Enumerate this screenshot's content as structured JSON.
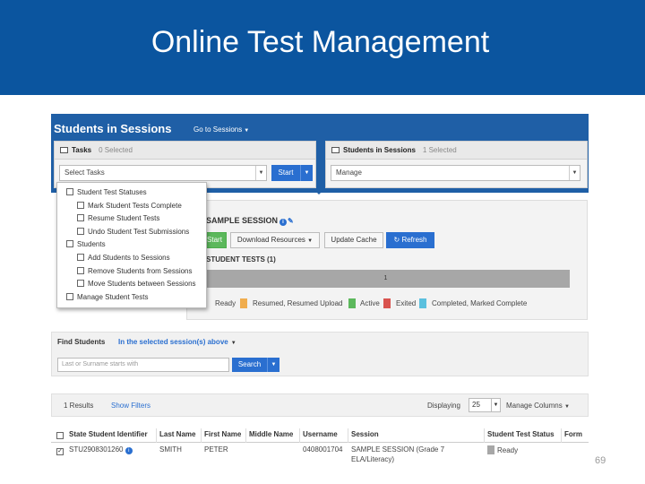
{
  "slide": {
    "title": "Online Test Management",
    "page_number": "69"
  },
  "header": {
    "title": "Students in Sessions",
    "goto_label": "Go to Sessions"
  },
  "tasks_panel": {
    "label": "Tasks",
    "count": "0 Selected",
    "select_value": "Select Tasks",
    "start_label": "Start"
  },
  "sis_panel": {
    "label": "Students in Sessions",
    "count": "1 Selected",
    "select_value": "Manage"
  },
  "dropdown": {
    "items": [
      {
        "label": "Student Test Statuses",
        "level": 0
      },
      {
        "label": "Mark Student Tests Complete",
        "level": 1
      },
      {
        "label": "Resume Student Tests",
        "level": 1
      },
      {
        "label": "Undo Student Test Submissions",
        "level": 1
      },
      {
        "label": "Students",
        "level": 0
      },
      {
        "label": "Add Students to Sessions",
        "level": 1
      },
      {
        "label": "Remove Students from Sessions",
        "level": 1
      },
      {
        "label": "Move Students between Sessions",
        "level": 1
      },
      {
        "label": "Manage Student Tests",
        "level": 0
      }
    ]
  },
  "session": {
    "name": "SAMPLE SESSION",
    "buttons": {
      "start": "Start",
      "download": "Download Resources",
      "update_cache": "Update Cache",
      "refresh": "Refresh"
    },
    "student_tests_label": "STUDENT TESTS (1)",
    "progress_value": "1",
    "legend": [
      {
        "label": "Ready",
        "color": "#a7a7a7"
      },
      {
        "label": "Resumed, Resumed Upload",
        "color": "#f0ad4e"
      },
      {
        "label": "Active",
        "color": "#5cb85c"
      },
      {
        "label": "Exited",
        "color": "#d9534f"
      },
      {
        "label": "Completed, Marked Complete",
        "color": "#5bc0de"
      }
    ]
  },
  "find": {
    "label": "Find Students",
    "scope": "In the selected session(s) above",
    "placeholder": "Last or Surname starts with",
    "search_label": "Search"
  },
  "results": {
    "count": "1 Results",
    "show_filters": "Show Filters",
    "displaying_label": "Displaying",
    "page_size": "25",
    "manage_columns": "Manage Columns"
  },
  "table": {
    "columns": [
      "State Student Identifier",
      "Last Name",
      "First Name",
      "Middle Name",
      "Username",
      "Session",
      "Student Test Status",
      "Form"
    ],
    "rows": [
      {
        "id": "STU2908301260",
        "last_name": "SMITH",
        "first_name": "PETER",
        "middle_name": "",
        "username": "0408001704",
        "session_line1": "SAMPLE SESSION (Grade 7",
        "session_line2": "ELA/Literacy)",
        "status": "Ready",
        "form": ""
      }
    ]
  }
}
